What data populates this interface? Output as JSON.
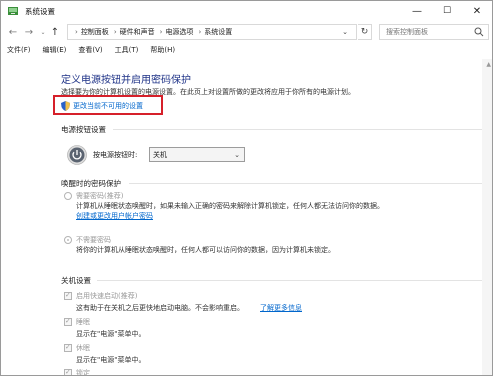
{
  "window": {
    "title": "系统设置",
    "minimize": "—",
    "maximize": "☐",
    "close": "✕"
  },
  "address": {
    "segments": [
      "控制面板",
      "硬件和声音",
      "电源选项",
      "系统设置"
    ],
    "search_placeholder": "搜索控制面板"
  },
  "menu": [
    "文件(F)",
    "编辑(E)",
    "查看(V)",
    "工具(T)",
    "帮助(H)"
  ],
  "main": {
    "title": "定义电源按钮并启用密码保护",
    "description": "选择要为你的计算机设置的电源设置。在此页上对设置所做的更改将应用于你所有的电源计划。",
    "change_link": "更改当前不可用的设置"
  },
  "power_button": {
    "section_title": "电源按钮设置",
    "label": "按电源按钮时:",
    "selected": "关机"
  },
  "wake_password": {
    "section_title": "唤醒时的密码保护",
    "options": [
      {
        "label": "需要密码(推荐)",
        "desc_lines": [
          "计算机从睡眠状态唤醒时，如果未输入正确的密码来解除计算机锁定，任何人都无法访问你的数据。"
        ],
        "link": "创建或更改用户帐户密码",
        "checked": false
      },
      {
        "label": "不需要密码",
        "desc_lines": [
          "将你的计算机从睡眠状态唤醒时，任何人都可以访问你的数据，因为计算机未锁定。"
        ],
        "checked": true
      }
    ]
  },
  "shutdown": {
    "section_title": "关机设置",
    "items": [
      {
        "label": "启用快速启动(推荐)",
        "desc": "这有助于在关机之后更快地启动电脑。不会影响重启。",
        "link": "了解更多信息",
        "checked": true
      },
      {
        "label": "睡眠",
        "desc": "显示在\"电源\"菜单中。",
        "checked": true
      },
      {
        "label": "休眠",
        "desc": "显示在\"电源\"菜单中。",
        "checked": true
      },
      {
        "label": "锁定",
        "desc": "",
        "checked": true
      }
    ]
  }
}
